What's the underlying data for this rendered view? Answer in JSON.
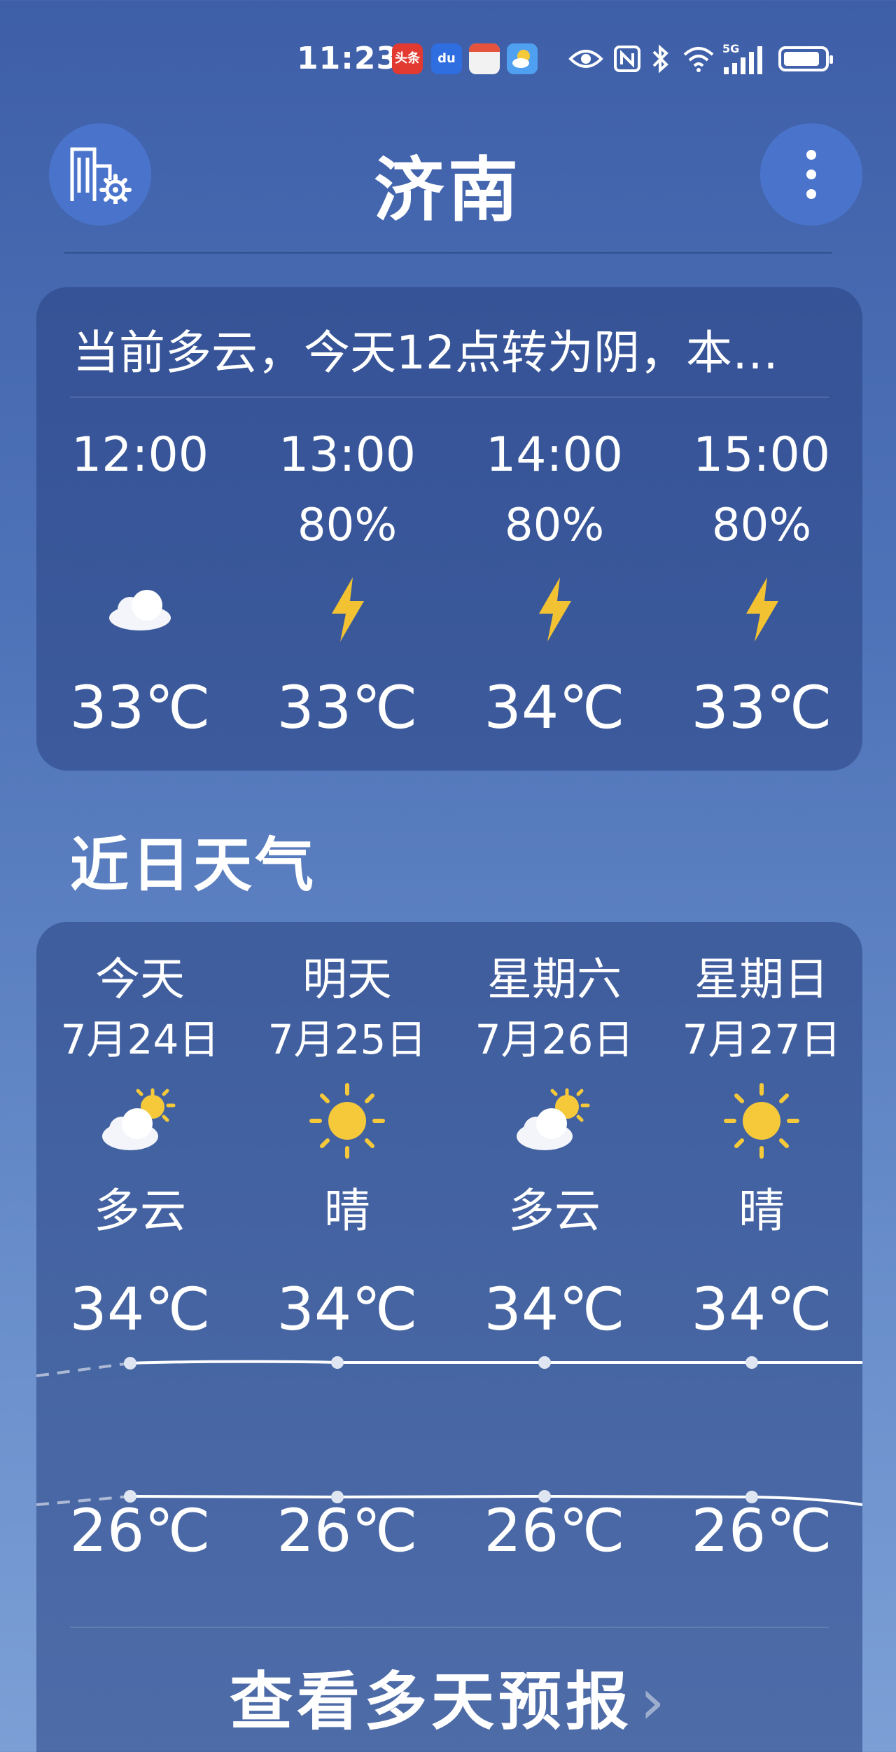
{
  "status_bar": {
    "time": "11:23",
    "notifications": [
      "toutiao-icon",
      "baidu-icon",
      "calendar-icon",
      "weather-icon"
    ],
    "toutiao_label": "头条",
    "baidu_label": "du",
    "network": "5G",
    "icons": [
      "eye-icon",
      "nfc-icon",
      "bluetooth-icon",
      "wifi-icon",
      "signal-icon",
      "battery-icon"
    ]
  },
  "header": {
    "city": "济南"
  },
  "hourly": {
    "summary": "当前多云，今天12点转为阴，本…",
    "items": [
      {
        "time": "12:00",
        "pop": "",
        "icon": "cloud-icon",
        "temp": "33℃"
      },
      {
        "time": "13:00",
        "pop": "80%",
        "icon": "lightning-icon",
        "temp": "33℃"
      },
      {
        "time": "14:00",
        "pop": "80%",
        "icon": "lightning-icon",
        "temp": "34℃"
      },
      {
        "time": "15:00",
        "pop": "80%",
        "icon": "lightning-icon",
        "temp": "33℃"
      }
    ]
  },
  "daily": {
    "title": "近日天气",
    "items": [
      {
        "day": "今天",
        "date": "7月24日",
        "icon": "partly-cloudy-icon",
        "condition": "多云",
        "high": "34℃",
        "low": "26℃"
      },
      {
        "day": "明天",
        "date": "7月25日",
        "icon": "sun-icon",
        "condition": "晴",
        "high": "34℃",
        "low": "26℃"
      },
      {
        "day": "星期六",
        "date": "7月26日",
        "icon": "partly-cloudy-icon",
        "condition": "多云",
        "high": "34℃",
        "low": "26℃"
      },
      {
        "day": "星期日",
        "date": "7月27日",
        "icon": "sun-icon",
        "condition": "晴",
        "high": "34℃",
        "low": "26℃"
      }
    ],
    "more_label": "查看多天预报"
  },
  "colors": {
    "accent_button": "#4a74cc",
    "sun": "#f5c93a",
    "lightning": "#f2c233"
  }
}
